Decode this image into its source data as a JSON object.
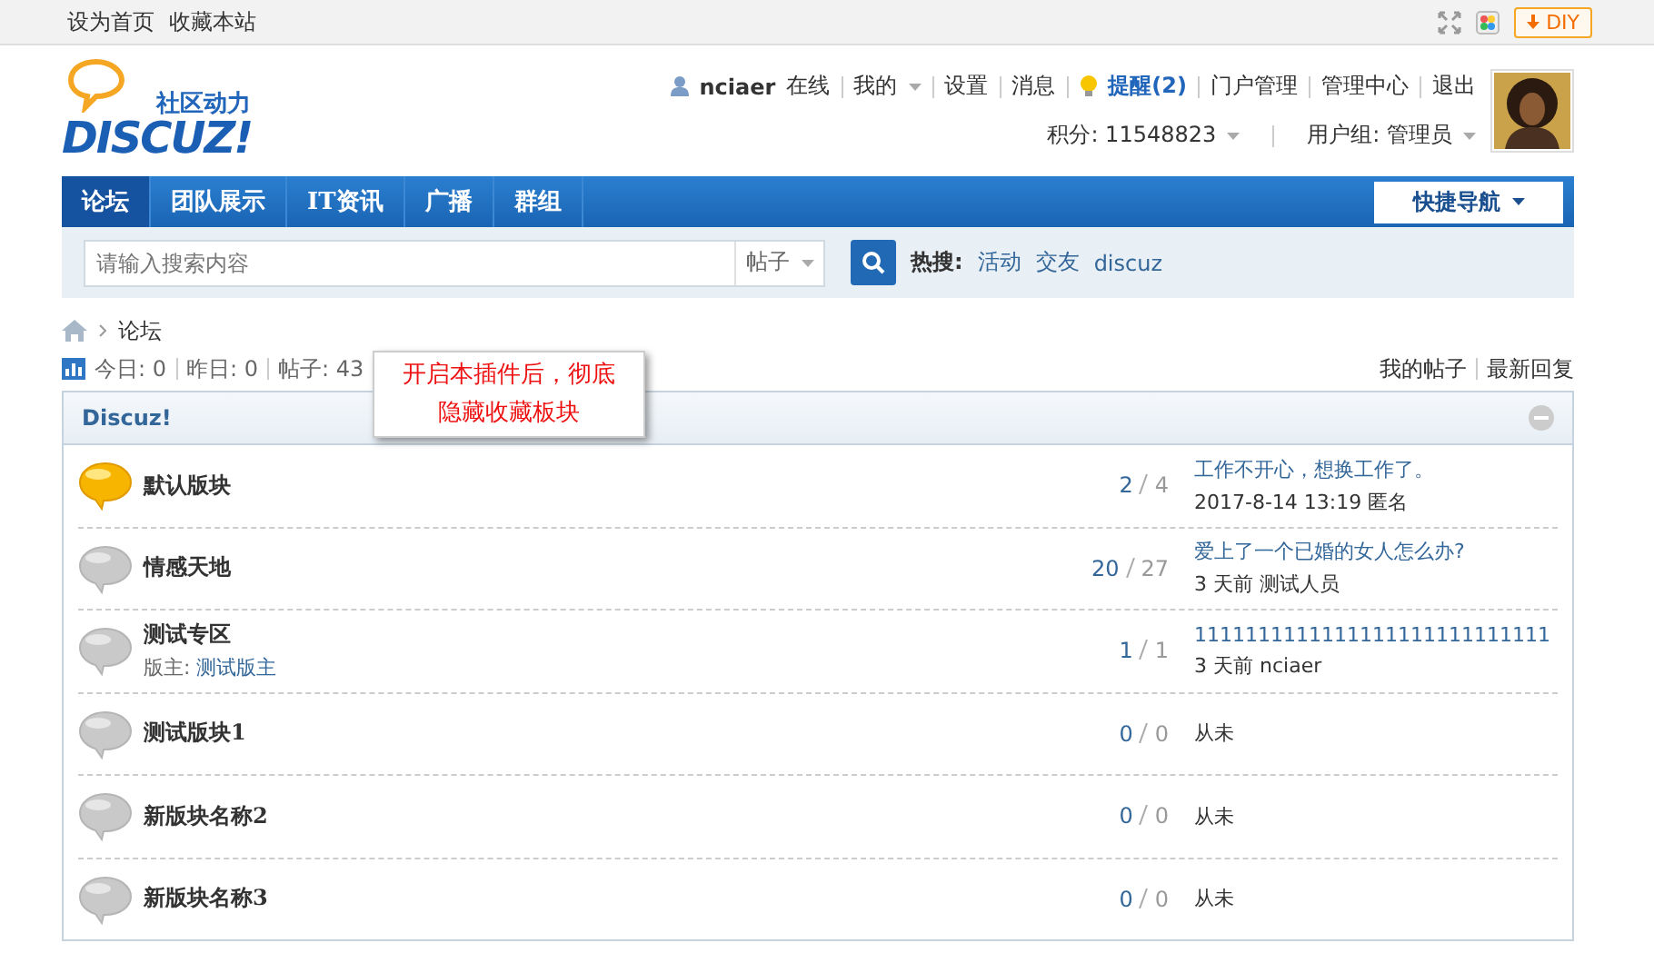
{
  "topbar": {
    "links": [
      "设为首页",
      "收藏本站"
    ],
    "diy": "DIY"
  },
  "header": {
    "slogan": "社区动力",
    "logo": "DISCUZ!",
    "user": "nciaer",
    "status": "在线",
    "menu": [
      {
        "label": "我的",
        "dropdown": true
      },
      {
        "label": "设置",
        "dropdown": false
      },
      {
        "label": "消息",
        "dropdown": false
      }
    ],
    "remind": "提醒(2)",
    "admin_links": [
      "门户管理",
      "管理中心",
      "退出"
    ],
    "credits": "积分: 11548823",
    "group": "用户组: 管理员"
  },
  "nav": {
    "items": [
      {
        "label": "论坛",
        "selected": true
      },
      {
        "label": "团队展示",
        "selected": false
      },
      {
        "label": "IT资讯",
        "selected": false
      },
      {
        "label": "广播",
        "selected": false
      },
      {
        "label": "群组",
        "selected": false
      }
    ],
    "quick": "快捷导航"
  },
  "search": {
    "placeholder": "请输入搜索内容",
    "type": "帖子",
    "hot_label": "热搜:",
    "hot": [
      "活动",
      "交友",
      "discuz"
    ]
  },
  "breadcrumb": [
    "论坛"
  ],
  "stats": [
    "今日: 0",
    "昨日: 0",
    "帖子: 43"
  ],
  "stat_links": [
    "我的帖子",
    "最新回复"
  ],
  "note": "开启本插件后，彻底隐藏收藏板块",
  "category": {
    "title": "Discuz!",
    "forums": [
      {
        "name": "默认版块",
        "has_new": true,
        "threads": "2",
        "posts": "4",
        "last_title": "工作不开心，想换工作了。",
        "last_time": "2017-8-14 13:19",
        "last_author": "匿名"
      },
      {
        "name": "情感天地",
        "has_new": false,
        "threads": "20",
        "posts": "27",
        "last_title": "爱上了一个已婚的女人怎么办?",
        "last_time": "3 天前",
        "last_author": "测试人员"
      },
      {
        "name": "测试专区",
        "has_new": false,
        "moderator_label": "版主:",
        "moderator": "测试版主",
        "threads": "1",
        "posts": "1",
        "last_title": "1111111111111111111111111111",
        "last_time": "3 天前",
        "last_author": "nciaer"
      },
      {
        "name": "测试版块1",
        "has_new": false,
        "threads": "0",
        "posts": "0",
        "never": "从未"
      },
      {
        "name": "新版块名称2",
        "has_new": false,
        "threads": "0",
        "posts": "0",
        "never": "从未"
      },
      {
        "name": "新版块名称3",
        "has_new": false,
        "threads": "0",
        "posts": "0",
        "never": "从未"
      }
    ]
  }
}
